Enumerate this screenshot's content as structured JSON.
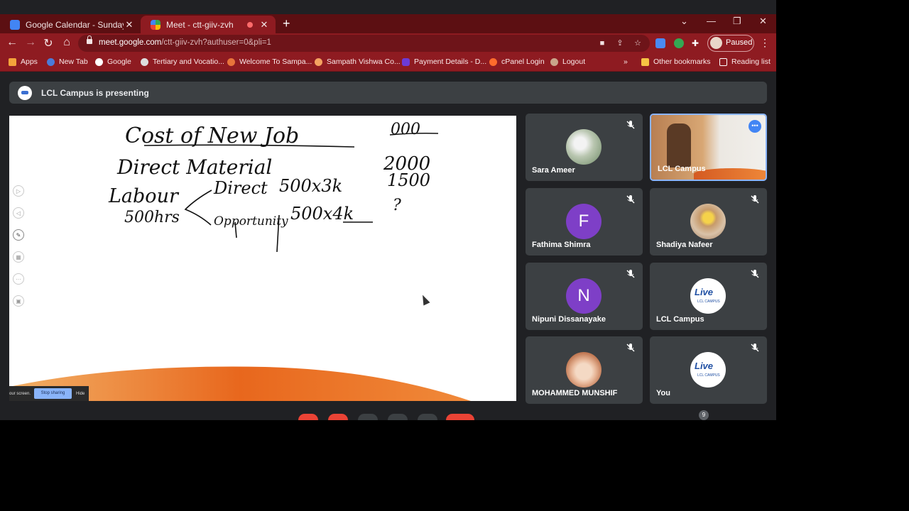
{
  "browser": {
    "tabs": [
      {
        "title": "Google Calendar - Sunday, Janua",
        "favicon": "calendar-icon",
        "active": false
      },
      {
        "title": "Meet - ctt-giiv-zvh",
        "favicon": "meet-icon",
        "active": true
      }
    ],
    "url_host": "meet.google.com",
    "url_path": "/ctt-giiv-zvh?authuser=0&pli=1",
    "profile_label": "Paused",
    "bookmarks": [
      {
        "label": "Apps",
        "icon": "apps-grid-icon"
      },
      {
        "label": "New Tab",
        "icon": "edge-icon"
      },
      {
        "label": "Google",
        "icon": "google-icon"
      },
      {
        "label": "Tertiary and Vocatio...",
        "icon": "globe-icon"
      },
      {
        "label": "Welcome To Sampa...",
        "icon": "sampath-icon"
      },
      {
        "label": "Sampath Vishwa Co...",
        "icon": "sampath-icon"
      },
      {
        "label": "Payment Details - D...",
        "icon": "payment-icon"
      },
      {
        "label": "cPanel Login",
        "icon": "cpanel-icon"
      },
      {
        "label": "Logout",
        "icon": "logout-icon"
      }
    ],
    "other_bookmarks": "Other bookmarks",
    "reading_list": "Reading list",
    "chevron": "»"
  },
  "meet": {
    "presenting_text": "LCL Campus is presenting",
    "whiteboard": {
      "line1": "Cost of New Job",
      "line1_value": "000",
      "line2": "Direct Material",
      "line2_value": "2000",
      "labour": "Labour",
      "hours": "500hrs",
      "direct": "Direct",
      "direct_calc": "500x3k",
      "direct_value": "1500",
      "opportunity": "Opportunity",
      "opportunity_calc": "500x4k",
      "opportunity_value": "?"
    },
    "share_bar": {
      "text": "our screen.",
      "stop": "Stop sharing",
      "hide": "Hide"
    },
    "participants": [
      {
        "name": "Sara Ameer",
        "avatar": "photo",
        "muted": true
      },
      {
        "name": "LCL Campus",
        "avatar": "video",
        "muted": false,
        "highlighted": true
      },
      {
        "name": "Fathima Shimra",
        "avatar": "letter",
        "letter": "F",
        "color": "#7e3fc7",
        "muted": true
      },
      {
        "name": "Shadiya Nafeer",
        "avatar": "photo",
        "muted": true
      },
      {
        "name": "Nipuni Dissanayake",
        "avatar": "letter",
        "letter": "N",
        "color": "#7e3fc7",
        "muted": true
      },
      {
        "name": "LCL Campus",
        "avatar": "logo",
        "muted": true
      },
      {
        "name": "MOHAMMED MUNSHIF",
        "avatar": "photo",
        "muted": true
      },
      {
        "name": "You",
        "avatar": "logo",
        "muted": true
      }
    ],
    "logo_text": "Live",
    "logo_sub": "LCL CAMPUS",
    "participant_count": "9"
  },
  "colors": {
    "chrome_frame": "#5c0f12",
    "chrome_toolbar": "#8e1b21",
    "meet_bg": "#202124",
    "tile_bg": "#3c4043",
    "accent_blue": "#8ab4f8"
  }
}
